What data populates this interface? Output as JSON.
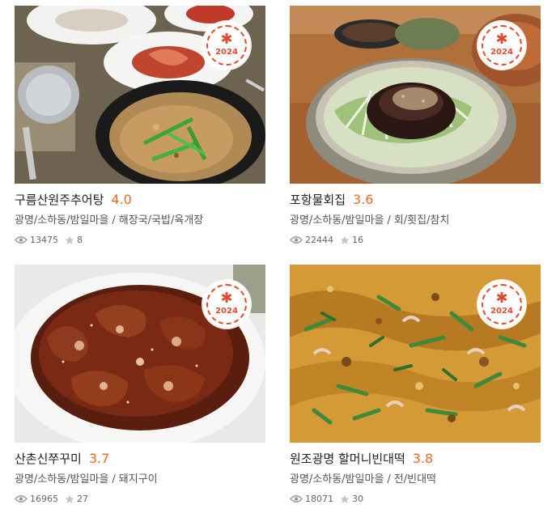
{
  "badge_year": "2024",
  "badge_symbol": "✱",
  "colors": {
    "accent": "#ea6a22",
    "badge": "#e04a2f",
    "text": "#222222",
    "meta": "#555555"
  },
  "restaurants": [
    {
      "name": "구름산원주추어탕",
      "rating": "4.0",
      "area": "광명/소하동/밤일마을",
      "category": "해장국/국밥/육개장",
      "views": "13475",
      "favorites": "8",
      "photo_icon": "loach-soup-photo"
    },
    {
      "name": "포항물회집",
      "rating": "3.6",
      "area": "광명/소하동/밤일마을",
      "category": "회/횟집/참치",
      "views": "22444",
      "favorites": "16",
      "photo_icon": "cold-raw-fish-soup-photo"
    },
    {
      "name": "산촌신쭈꾸미",
      "rating": "3.7",
      "area": "광명/소하동/밤일마을",
      "category": "돼지구이",
      "views": "16965",
      "favorites": "27",
      "photo_icon": "spicy-webfoot-octopus-photo"
    },
    {
      "name": "원조광명 할머니빈대떡",
      "rating": "3.8",
      "area": "광명/소하동/밤일마을",
      "category": "전/빈대떡",
      "views": "18071",
      "favorites": "30",
      "photo_icon": "mung-bean-pancake-photo"
    }
  ]
}
